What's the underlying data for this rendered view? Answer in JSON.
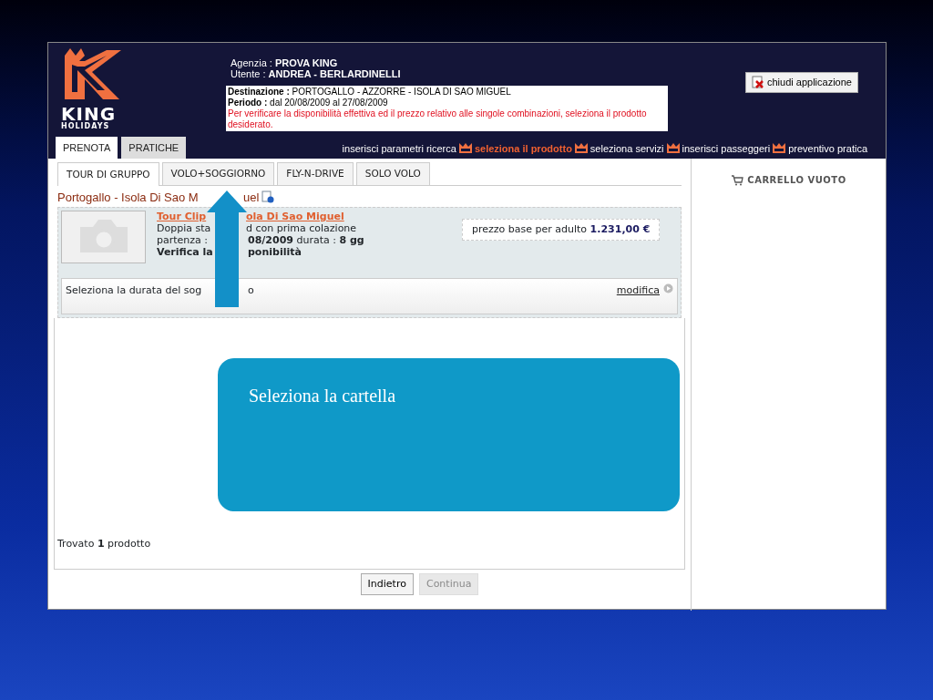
{
  "slide": {
    "callout": "Seleziona la cartella"
  },
  "logo": {
    "name": "KING",
    "tagline": "HOLIDAYS"
  },
  "header": {
    "agency_label": "Agenzia :",
    "agency": "PROVA KING",
    "user_label": "Utente :",
    "user": "ANDREA - BERLARDINELLI",
    "info": {
      "destination_label": "Destinazione :",
      "destination": "PORTOGALLO - AZZORRE - ISOLA DI SAO MIGUEL",
      "period_label": "Periodo :",
      "period": "dal 20/08/2009 al 27/08/2009",
      "notice": "Per verificare la disponibilità effettiva ed il prezzo relativo alle singole combinazioni, seleziona il prodotto desiderato."
    },
    "close_button": "chiudi applicazione"
  },
  "main_tabs": [
    {
      "label": "PRENOTA",
      "selected": true
    },
    {
      "label": "PRATICHE",
      "selected": false
    }
  ],
  "steps": [
    {
      "label": "inserisci parametri ricerca",
      "selected": false
    },
    {
      "label": "seleziona il prodotto",
      "selected": true
    },
    {
      "label": "seleziona servizi",
      "selected": false
    },
    {
      "label": "inserisci passeggeri",
      "selected": false
    },
    {
      "label": "preventivo pratica",
      "selected": false
    }
  ],
  "sub_tabs": [
    {
      "label": "TOUR DI GRUPPO",
      "selected": true
    },
    {
      "label": "VOLO+SOGGIORNO",
      "selected": false
    },
    {
      "label": "FLY-N-DRIVE",
      "selected": false
    },
    {
      "label": "SOLO VOLO",
      "selected": false
    }
  ],
  "destination_title": [
    "Portogallo - Isola Di Sao M",
    "uel"
  ],
  "product": {
    "title": [
      "Tour Clip",
      "ola Di Sao Miguel"
    ],
    "lines": [
      [
        "Doppia sta",
        "d con prima colazione"
      ],
      [
        "partenza :",
        "**08/2009** durata : **8 gg**"
      ],
      [
        "Verifica la",
        "ponibilità"
      ]
    ],
    "price_label": "prezzo base per adulto",
    "price": "1.231,00 €"
  },
  "duration": {
    "text": [
      "Seleziona la durata del sog",
      "o"
    ],
    "link": "modifica"
  },
  "result": "Trovato **1** prodotto",
  "buttons": [
    {
      "label": "Indietro",
      "disabled": false
    },
    {
      "label": "Continua",
      "disabled": true
    }
  ],
  "cart": "CARRELLO VUOTO"
}
